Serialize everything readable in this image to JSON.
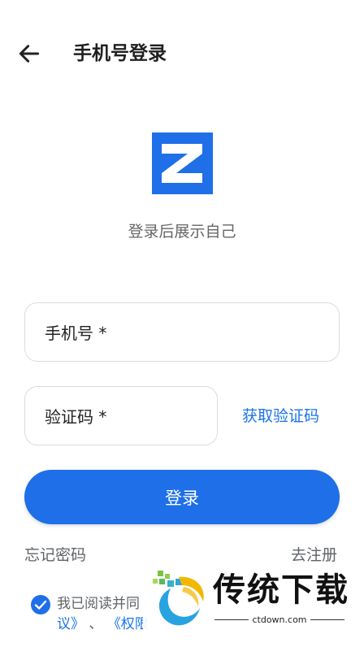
{
  "header": {
    "title": "手机号登录"
  },
  "brand": {
    "tagline": "登录后展示自己",
    "accent": "#1e6fe8"
  },
  "form": {
    "phone_placeholder": "手机号 *",
    "code_placeholder": "验证码 *",
    "get_code_label": "获取验证码",
    "login_label": "登录"
  },
  "links": {
    "forgot_label": "忘记密码",
    "register_label": "去注册"
  },
  "agreement": {
    "checked": true,
    "line1": "我已阅读并同",
    "line2_a": "议》",
    "line2_sep": "、",
    "line2_b": "《权限"
  },
  "watermark": {
    "text": "传统下载",
    "url": "ctdown.com"
  }
}
